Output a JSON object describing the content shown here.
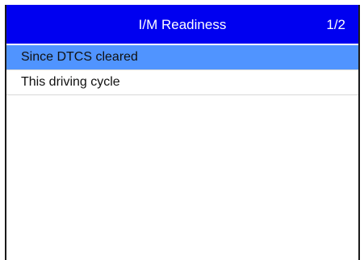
{
  "header": {
    "title": "I/M Readiness",
    "page_indicator": "1/2"
  },
  "menu": {
    "items": [
      {
        "label": "Since DTCS cleared",
        "selected": true
      },
      {
        "label": "This driving cycle",
        "selected": false
      }
    ]
  },
  "colors": {
    "titlebar_background": "#0000f0",
    "selected_background": "#5094ff",
    "text": "#111111"
  }
}
